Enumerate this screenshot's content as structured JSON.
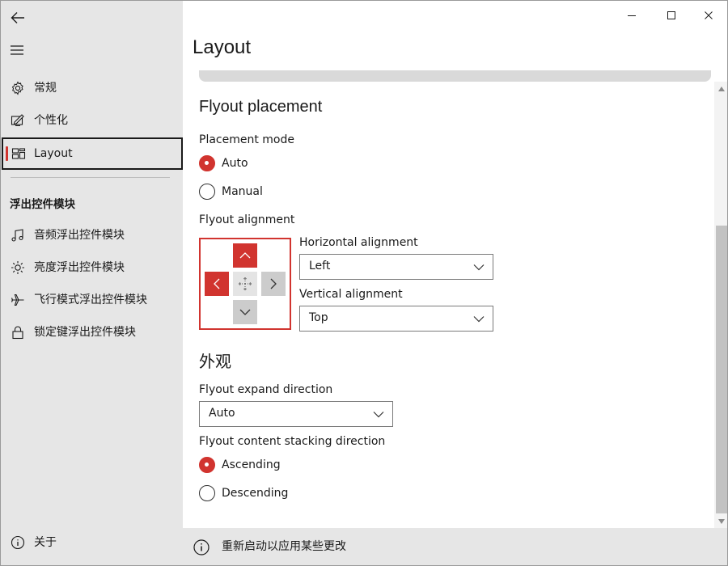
{
  "sidebar": {
    "back_icon": "back-arrow-icon",
    "menu_icon": "hamburger-icon",
    "items": [
      {
        "label": "常规",
        "icon": "gear-icon"
      },
      {
        "label": "个性化",
        "icon": "personalize-pen-icon"
      },
      {
        "label": "Layout",
        "icon": "layout-icon",
        "selected": true
      }
    ],
    "section_header": "浮出控件模块",
    "modules": [
      {
        "label": "音频浮出控件模块",
        "icon": "music-note-icon"
      },
      {
        "label": "亮度浮出控件模块",
        "icon": "brightness-icon"
      },
      {
        "label": "飞行模式浮出控件模块",
        "icon": "airplane-icon"
      },
      {
        "label": "锁定键浮出控件模块",
        "icon": "lock-icon"
      }
    ],
    "about": {
      "label": "关于",
      "icon": "info-icon"
    }
  },
  "window": {
    "minimize_icon": "minimize-icon",
    "maximize_icon": "maximize-icon",
    "close_icon": "close-icon"
  },
  "page": {
    "title": "Layout",
    "flyout_placement": {
      "heading": "Flyout placement",
      "placement_mode_label": "Placement mode",
      "options": [
        {
          "label": "Auto",
          "checked": true
        },
        {
          "label": "Manual",
          "checked": false
        }
      ]
    },
    "flyout_alignment": {
      "label": "Flyout alignment",
      "horizontal_label": "Horizontal alignment",
      "horizontal_value": "Left",
      "vertical_label": "Vertical alignment",
      "vertical_value": "Top"
    },
    "appearance": {
      "heading": "外观",
      "expand_label": "Flyout expand direction",
      "expand_value": "Auto",
      "stacking_label": "Flyout content stacking direction",
      "stacking_options": [
        {
          "label": "Ascending",
          "checked": true
        },
        {
          "label": "Descending",
          "checked": false
        }
      ]
    }
  },
  "info_bar": {
    "icon": "info-icon",
    "text": "重新启动以应用某些更改"
  },
  "colors": {
    "accent": "#d1342f",
    "sidebar_bg": "#e6e6e6"
  }
}
